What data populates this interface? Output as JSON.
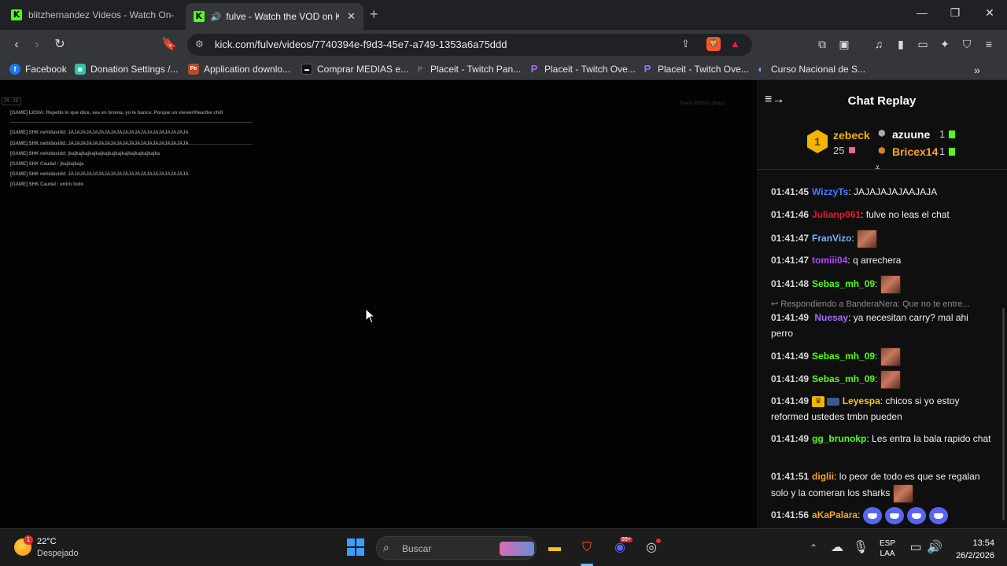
{
  "tabs": [
    {
      "title": "blitzhernandez Videos - Watch On-Dem",
      "active": false
    },
    {
      "title": "fulve - Watch the VOD on Kick",
      "active": true
    }
  ],
  "address": {
    "url": "kick.com/fulve/videos/7740394e-f9d3-45e7-a749-1353a6a75ddd"
  },
  "bookmarks": [
    {
      "label": "Facebook",
      "icon": "facebook-icon",
      "color": "#1877f2"
    },
    {
      "label": "Donation Settings /...",
      "icon": "streamlabs-icon",
      "color": "#31c3a2"
    },
    {
      "label": "Application downlo...",
      "icon": "application-icon",
      "color": "#b84a2e"
    },
    {
      "label": "Comprar MEDIAS e...",
      "icon": "store-icon",
      "color": "#111111"
    },
    {
      "label": "Placeit - Twitch Pan...",
      "icon": "placeit-icon",
      "color": "#555555"
    },
    {
      "label": "Placeit - Twitch Ove...",
      "icon": "placeit-p-icon",
      "color": "#7b2ff7"
    },
    {
      "label": "Placeit - Twitch Ove...",
      "icon": "placeit-p-icon",
      "color": "#7b2ff7"
    },
    {
      "label": "Curso Nacional de S...",
      "icon": "course-icon",
      "color": "#6b7cff"
    }
  ],
  "video": {
    "fps_label": "Pl : 23",
    "corner_text": "FiveM (b3095) (Beta)",
    "overlay_lines": [
      "[GAME] LICHA: Repetín lo que dice, sea en broma, yo te banco. Porque un viewer/Heartbe chill",
      "[GAME] SHK nehldavidd: JAJAJAJAJAJAJAJAJAJAJAJAJAJAJAJAJAJAJAJA",
      "[GAME] SHK nehldavidd: JAJAJAJAJAJAJAJAJAJAJAJAJAJAJAJAJAJAJAJA",
      "[GAME] SHK nehldavidd: jkajkajkajkajkajkajkajkajkajkajkajkajkajka",
      "[GAME] SHK Caudal : jkajkajkaja",
      "[GAME] SHK nehldavidd: JAJAJAJAJAJAJAJAJAJAJAJAJAJAJAJAJAJAJAJA",
      "[GAME] SHK Caudal : entro todo"
    ]
  },
  "chat": {
    "title": "Chat Replay",
    "leaderboard": {
      "first": {
        "rank": "1",
        "name": "zebeck",
        "count": "25"
      },
      "others": [
        {
          "name": "azuune",
          "count": "1"
        },
        {
          "name": "Bricex14",
          "count": "1"
        }
      ]
    },
    "reply_notice": "Respondiendo a BanderaNera: Que no te entre...",
    "messages": [
      {
        "time": "01:41:45",
        "user": "WizzyTs",
        "color": "#4a7cff",
        "text": ": JAJAJAJAJAAJAJA"
      },
      {
        "time": "01:41:46",
        "user": "Julianp061",
        "color": "#e8192c",
        "text": ": fulve no leas el chat"
      },
      {
        "time": "01:41:47",
        "user": "FranVizo",
        "color": "#7bb0ff",
        "text": ":"
      },
      {
        "time": "01:41:47",
        "user": "tomiii04",
        "color": "#b04aff",
        "text": ": q arrechera"
      },
      {
        "time": "01:41:48",
        "user": "Sebas_mh_09",
        "color": "#53fc18",
        "text": ":"
      },
      {
        "time": "01:41:49",
        "user": "Nuesay",
        "color": "#a06cff",
        "text": ": ya necesitan carry? mal ahi perro"
      },
      {
        "time": "01:41:49",
        "user": "Sebas_mh_09",
        "color": "#53fc18",
        "text": ":"
      },
      {
        "time": "01:41:49",
        "user": "Sebas_mh_09",
        "color": "#53fc18",
        "text": ":"
      },
      {
        "time": "01:41:49",
        "user": "Leyespa",
        "color": "#f5c518",
        "text": ": chicos si yo estoy reformed ustedes tmbn pueden"
      },
      {
        "time": "01:41:49",
        "user": "gg_brunokp",
        "color": "#53fc18",
        "text": ": Les entra la bala rapido chat"
      },
      {
        "time": "01:41:51",
        "user": "diglii",
        "color": "#f5a623",
        "text": ": lo peor de todo es que se regalan solo y la comeran los sharks"
      },
      {
        "time": "01:41:56",
        "user": "aKaPalara",
        "color": "#f5a623",
        "text": ":"
      }
    ]
  },
  "taskbar": {
    "weather_temp": "22°C",
    "weather_desc": "Despejado",
    "weather_badge": "1",
    "search_placeholder": "Buscar",
    "lang1": "ESP",
    "lang2": "LAA",
    "time": "13:54",
    "date": "26/2/2026",
    "discord_badge": "99+"
  },
  "colors": {
    "kick_green": "#53fc18",
    "chat_bg": "#0f0f0f"
  }
}
